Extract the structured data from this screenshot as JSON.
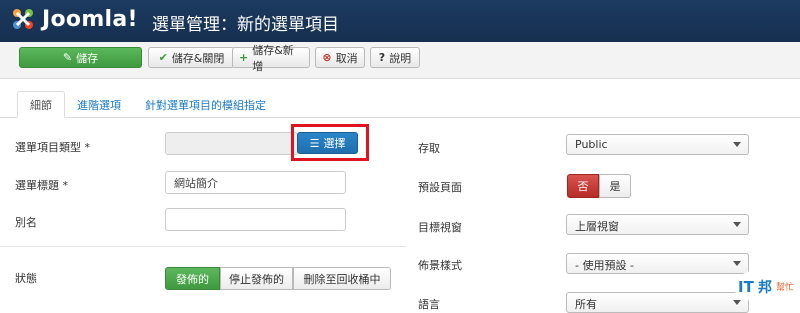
{
  "header": {
    "brand": "Joomla!",
    "title": "選單管理：新的選單項目"
  },
  "toolbar": {
    "save": "儲存",
    "save_close": "儲存&關閉",
    "save_new": "儲存&新增",
    "cancel": "取消",
    "help": "說明"
  },
  "tabs": [
    "細節",
    "進階選項",
    "針對選單項目的模組指定"
  ],
  "form_left": {
    "type_label": "選單項目類型 *",
    "type_value": "",
    "select_button": "選擇",
    "title_label": "選單標題 *",
    "title_value": "網站簡介",
    "alias_label": "別名",
    "alias_value": "",
    "status_label": "狀態",
    "status_options": [
      "發佈的",
      "停止發佈的",
      "刪除至回收桶中"
    ]
  },
  "form_right": {
    "access_label": "存取",
    "access_value": "Public",
    "default_label": "預設頁面",
    "default_options": [
      "否",
      "是"
    ],
    "target_label": "目標視窗",
    "target_value": "上層視窗",
    "layout_label": "佈景樣式",
    "layout_value": "- 使用預設 -",
    "language_label": "語言",
    "language_value": "所有"
  },
  "watermark": {
    "text1": "IT",
    "text2": "邦",
    "text3": "幫忙"
  }
}
